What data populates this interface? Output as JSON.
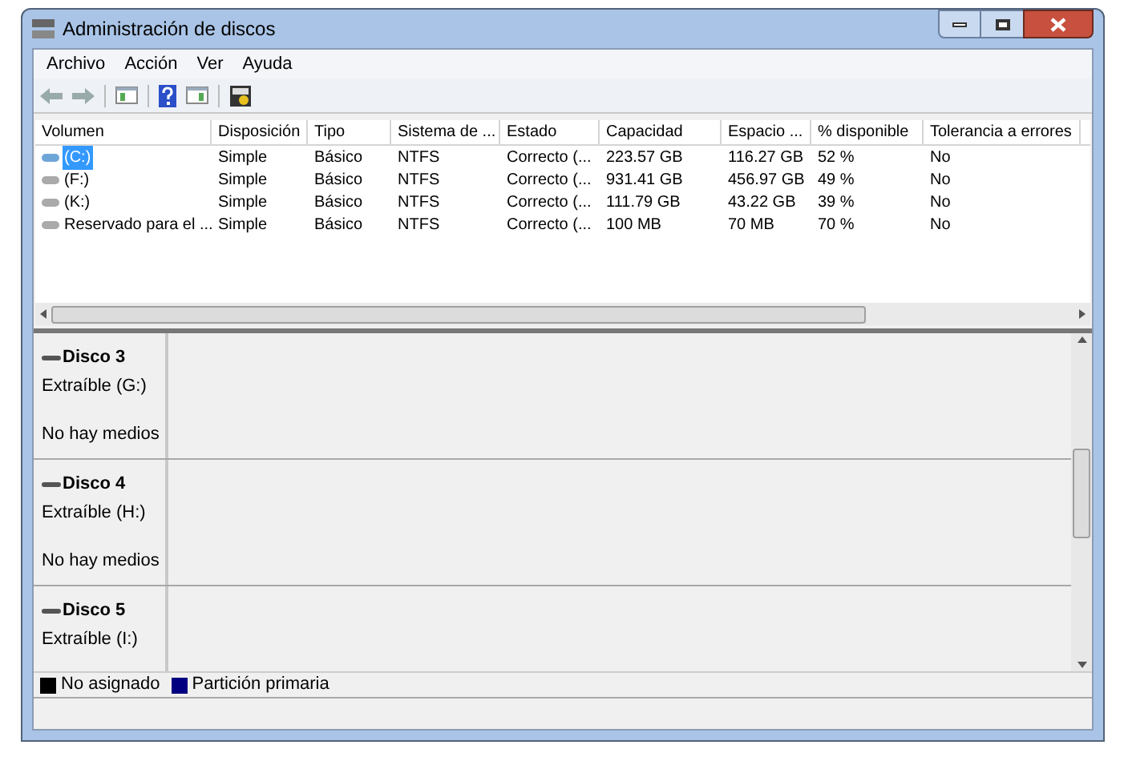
{
  "window": {
    "title": "Administración de discos"
  },
  "menu": [
    "Archivo",
    "Acción",
    "Ver",
    "Ayuda"
  ],
  "table": {
    "columns": [
      "Volumen",
      "Disposición",
      "Tipo",
      "Sistema de ...",
      "Estado",
      "Capacidad",
      "Espacio ...",
      "% disponible",
      "Tolerancia a errores"
    ],
    "rows": [
      {
        "selected": true,
        "cells": [
          "(C:)",
          "Simple",
          "Básico",
          "NTFS",
          "Correcto (...",
          "223.57 GB",
          "116.27 GB",
          "52 %",
          "No"
        ]
      },
      {
        "selected": false,
        "cells": [
          "(F:)",
          "Simple",
          "Básico",
          "NTFS",
          "Correcto (...",
          "931.41 GB",
          "456.97 GB",
          "49 %",
          "No"
        ]
      },
      {
        "selected": false,
        "cells": [
          "(K:)",
          "Simple",
          "Básico",
          "NTFS",
          "Correcto (...",
          "111.79 GB",
          "43.22 GB",
          "39 %",
          "No"
        ]
      },
      {
        "selected": false,
        "cells": [
          "Reservado para el ...",
          "Simple",
          "Básico",
          "NTFS",
          "Correcto (...",
          "100 MB",
          "70 MB",
          "70 %",
          "No"
        ]
      }
    ]
  },
  "disks": [
    {
      "name": "Disco 3",
      "type": "Extraíble (G:)",
      "status": "No hay medios"
    },
    {
      "name": "Disco 4",
      "type": "Extraíble (H:)",
      "status": "No hay medios"
    },
    {
      "name": "Disco 5",
      "type": "Extraíble (I:)"
    }
  ],
  "legend": [
    {
      "label": "No asignado",
      "color": "#000000"
    },
    {
      "label": "Partición primaria",
      "color": "#000080"
    }
  ]
}
